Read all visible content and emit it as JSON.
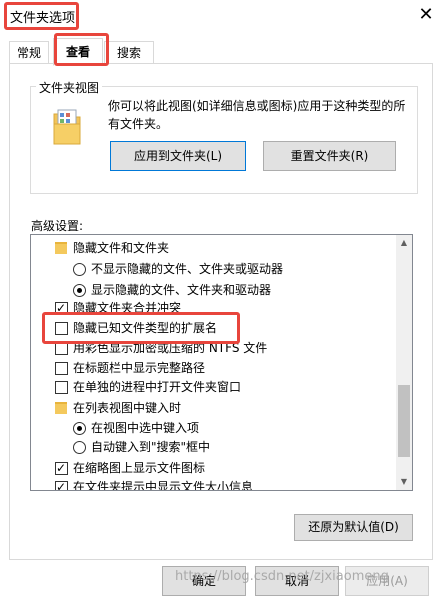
{
  "window": {
    "title": "文件夹选项",
    "close_glyph": "✕"
  },
  "tabs": [
    {
      "label": "常规"
    },
    {
      "label": "查看"
    },
    {
      "label": "搜索"
    }
  ],
  "folder_views": {
    "group_title": "文件夹视图",
    "description": "你可以将此视图(如详细信息或图标)应用于这种类型的所有文件夹。",
    "apply_button": "应用到文件夹(L)",
    "reset_button": "重置文件夹(R)"
  },
  "advanced": {
    "label": "高级设置:",
    "items": [
      {
        "type": "folder",
        "label": "隐藏文件和文件夹"
      },
      {
        "type": "radio",
        "checked": false,
        "label": "不显示隐藏的文件、文件夹或驱动器"
      },
      {
        "type": "radio",
        "checked": true,
        "label": "显示隐藏的文件、文件夹和驱动器"
      },
      {
        "type": "checkbox",
        "checked": true,
        "label": "隐藏文件夹合并冲突"
      },
      {
        "type": "checkbox",
        "checked": false,
        "label": "隐藏已知文件类型的扩展名"
      },
      {
        "type": "checkbox",
        "checked": false,
        "label": "用彩色显示加密或压缩的 NTFS 文件"
      },
      {
        "type": "checkbox",
        "checked": false,
        "label": "在标题栏中显示完整路径"
      },
      {
        "type": "checkbox",
        "checked": false,
        "label": "在单独的进程中打开文件夹窗口"
      },
      {
        "type": "folder",
        "label": "在列表视图中键入时"
      },
      {
        "type": "radio",
        "checked": true,
        "label": "在视图中选中键入项"
      },
      {
        "type": "radio",
        "checked": false,
        "label": "自动键入到\"搜索\"框中"
      },
      {
        "type": "checkbox",
        "checked": true,
        "label": "在缩略图上显示文件图标"
      },
      {
        "type": "checkbox",
        "checked": true,
        "label": "在文件夹提示中显示文件大小信息"
      }
    ],
    "restore_button": "还原为默认值(D)"
  },
  "footer": {
    "ok": "确定",
    "cancel": "取消",
    "apply": "应用(A)"
  },
  "watermark": "https://blog.csdn.net/zjxiaomeng",
  "colors": {
    "highlight": "#e8453c",
    "focus_border": "#0078d7",
    "folder": "#f4c95d"
  }
}
